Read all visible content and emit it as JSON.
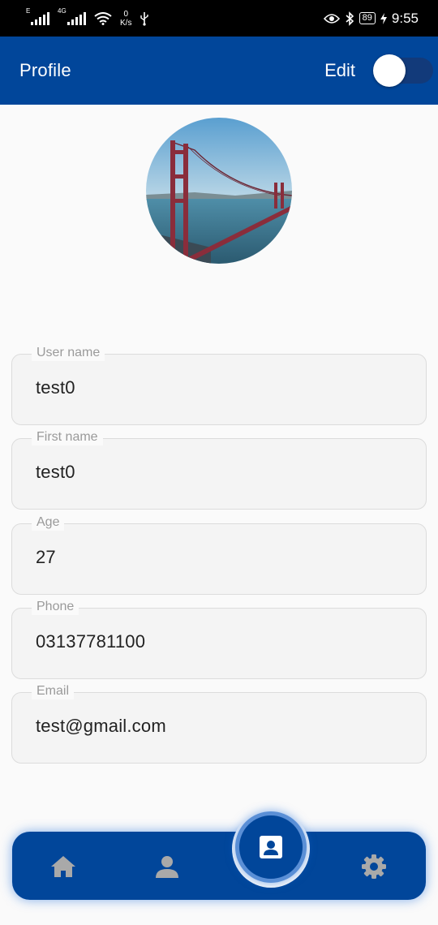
{
  "status_bar": {
    "sim1_tag": "E",
    "sim2_tag": "4G",
    "net_speed_value": "0",
    "net_speed_unit": "K/s",
    "battery_level": "89",
    "time": "9:55"
  },
  "app_bar": {
    "title": "Profile",
    "edit_label": "Edit",
    "edit_toggle_on": false
  },
  "profile": {
    "avatar_icon": "golden-gate-bridge-photo",
    "fields": [
      {
        "label": "User name",
        "value": "test0"
      },
      {
        "label": "First name",
        "value": "test0"
      },
      {
        "label": "Age",
        "value": "27"
      },
      {
        "label": "Phone",
        "value": "03137781100"
      },
      {
        "label": "Email",
        "value": "test@gmail.com"
      }
    ]
  },
  "bottom_nav": {
    "items": [
      {
        "icon": "home-icon"
      },
      {
        "icon": "person-icon"
      },
      {
        "icon": "contact-card-icon",
        "active": true
      },
      {
        "icon": "gear-icon"
      }
    ]
  },
  "colors": {
    "primary": "#01469a",
    "accent_glow": "#5a8fd6",
    "background": "#fafafa",
    "field_bg": "#f4f4f4"
  }
}
